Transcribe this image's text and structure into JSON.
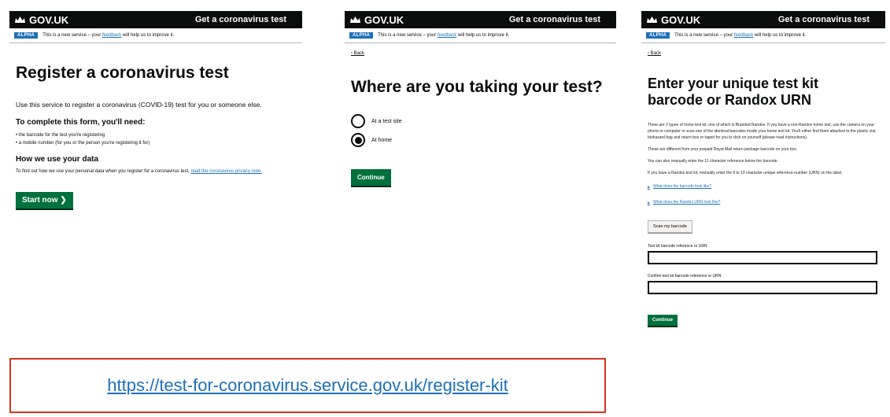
{
  "common": {
    "brand": "GOV.UK",
    "service_name": "Get a coronavirus test",
    "phase_tag": "ALPHA",
    "phase_text_before": "This is a new service – your",
    "phase_link": "feedback",
    "phase_text_after": "will help us to improve it.",
    "back_link": "Back"
  },
  "panel1": {
    "title": "Register a coronavirus test",
    "lead": "Use this service to register a coronavirus (COVID-19) test for you or someone else.",
    "need_heading": "To complete this form, you'll need:",
    "need_items": [
      "the barcode for the test you're registering",
      "a mobile number (for you or the person you're registering it for)"
    ],
    "data_heading": "How we use your data",
    "data_text": "To find out how we use your personal data when you register for a coronavirus test,",
    "data_link": "read the coronavirus privacy note.",
    "start_button": "Start now ❯"
  },
  "panel2": {
    "title": "Where are you taking your test?",
    "options": [
      "At a test site",
      "At home"
    ],
    "selected_index": 1,
    "continue_button": "Continue"
  },
  "panel3": {
    "title": "Enter your unique test kit barcode or Randox URN",
    "paragraphs": [
      "There are 2 types of home test kit, one of which is Branded Randox. If you have a non-Randox home test, use the camera on your phone or computer to scan one of the identical barcodes inside your home test kit. You'll either find them attached to the plastic vial, biohazard bag and return box or taped for you to click on yourself (please read instructions).",
      "These are different from your prepaid Royal Mail return package barcode on your box.",
      "You can also manually enter the 11 character reference below the barcode.",
      "If you have a Randox test kit, manually enter the 9 to 10 character unique reference number (URN) on the label."
    ],
    "details": [
      "What does the barcode look like?",
      "What does the Randox URN look like?"
    ],
    "scan_button": "Scan my barcode",
    "field1_label": "Test kit barcode reference or URN",
    "field2_label": "Confirm test kit barcode reference or URN",
    "continue_button": "Continue"
  },
  "url": "https://test-for-coronavirus.service.gov.uk/register-kit"
}
